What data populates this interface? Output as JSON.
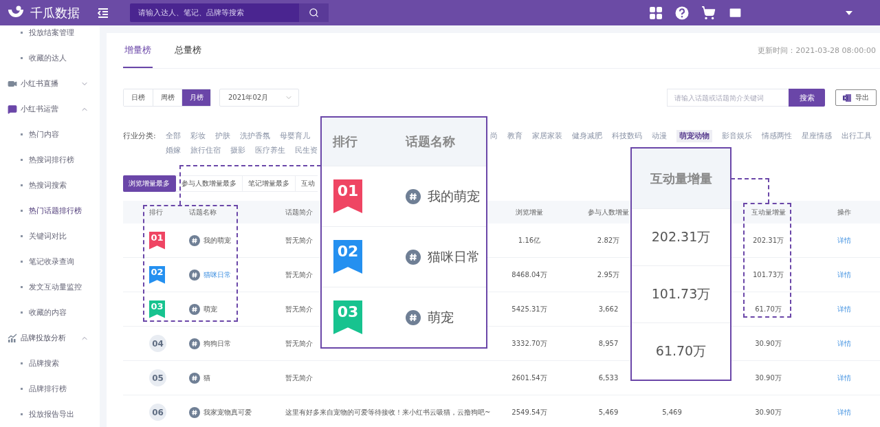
{
  "app": {
    "logo": "千瓜数据",
    "search_placeholder": "请输入达人、笔记、品牌等搜索"
  },
  "sidebar": {
    "items": [
      {
        "kind": "link",
        "label": "投放结案管理",
        "selected": false
      },
      {
        "kind": "link",
        "label": "收藏的达人",
        "selected": false
      },
      {
        "kind": "group",
        "label": "小红书直播",
        "expanded": false
      },
      {
        "kind": "group",
        "label": "小红书运营",
        "expanded": true,
        "children": [
          {
            "kind": "link",
            "label": "热门内容",
            "selected": false
          },
          {
            "kind": "link",
            "label": "热搜词排行榜",
            "selected": false
          },
          {
            "kind": "link",
            "label": "热搜词搜索",
            "selected": false
          },
          {
            "kind": "link",
            "label": "热门话题排行榜",
            "selected": true
          },
          {
            "kind": "link",
            "label": "关键词对比",
            "selected": false
          },
          {
            "kind": "link",
            "label": "笔记收录查询",
            "selected": false
          },
          {
            "kind": "link",
            "label": "发文互动量监控",
            "selected": false
          },
          {
            "kind": "link",
            "label": "收藏的内容",
            "selected": false
          }
        ]
      },
      {
        "kind": "group",
        "label": "品牌投放分析",
        "expanded": true,
        "children": [
          {
            "kind": "link",
            "label": "品牌搜索",
            "selected": false
          },
          {
            "kind": "link",
            "label": "品牌排行榜",
            "selected": false
          },
          {
            "kind": "link",
            "label": "投放报告导出",
            "selected": false
          }
        ]
      }
    ]
  },
  "board_tabs": [
    {
      "label": "增量榜",
      "selected": true
    },
    {
      "label": "总量榜",
      "selected": false
    }
  ],
  "update_time": "更新时间：2021-03-28 08:00:00",
  "period_tabs": [
    {
      "label": "日榜",
      "selected": false
    },
    {
      "label": "周榜",
      "selected": false
    },
    {
      "label": "月榜",
      "selected": true
    }
  ],
  "month_select": {
    "value": "2021年02月"
  },
  "topic_search": {
    "placeholder": "请输入话题或话题简介关键词",
    "button": "搜索"
  },
  "export_button": "导出",
  "industry": {
    "label": "行业分类:",
    "groups": [
      {
        "items": [
          {
            "label": "全部",
            "selected": false
          },
          {
            "label": "彩妆",
            "selected": false
          },
          {
            "label": "护肤",
            "selected": false
          },
          {
            "label": "洗护香氛",
            "selected": false
          },
          {
            "label": "母婴育儿",
            "selected": false
          }
        ]
      },
      {
        "items": [
          {
            "label": "尚",
            "selected": false
          },
          {
            "label": "教育",
            "selected": false
          },
          {
            "label": "家居家装",
            "selected": false
          },
          {
            "label": "健身减肥",
            "selected": false
          },
          {
            "label": "科技数码",
            "selected": false
          },
          {
            "label": "动漫",
            "selected": false
          },
          {
            "label": "萌宠动物",
            "selected": true
          },
          {
            "label": "影音娱乐",
            "selected": false
          },
          {
            "label": "情感两性",
            "selected": false
          },
          {
            "label": "星座情感",
            "selected": false
          },
          {
            "label": "出行工具",
            "selected": false
          }
        ]
      },
      {
        "items": [
          {
            "label": "婚嫁",
            "selected": false
          },
          {
            "label": "旅行住宿",
            "selected": false
          },
          {
            "label": "摄影",
            "selected": false
          },
          {
            "label": "医疗养生",
            "selected": false
          },
          {
            "label": "民生资",
            "selected": false
          }
        ]
      }
    ]
  },
  "sort_tabs": [
    {
      "label": "浏览增量最多",
      "selected": true
    },
    {
      "label": "参与人数增量最多",
      "selected": false
    },
    {
      "label": "笔记增量最多",
      "selected": false
    },
    {
      "label": "互动",
      "selected": false
    }
  ],
  "table": {
    "columns": [
      {
        "kind": "rank",
        "label": "排行"
      },
      {
        "kind": "topic",
        "label": "话题名称"
      },
      {
        "kind": "text",
        "label": "话题简介"
      },
      {
        "kind": "number",
        "label": "浏览增量"
      },
      {
        "kind": "number",
        "label": "参与人数增量"
      },
      {
        "kind": "number"
      },
      {
        "kind": "number",
        "label": "互动量增量"
      },
      {
        "kind": "link",
        "label": "操作"
      }
    ],
    "rows": [
      {
        "rank": "01",
        "kind": "ribbon",
        "color": "#ef4563",
        "name": "我的萌宠",
        "highlighted": false,
        "intro": "暂无简介",
        "views": "1.16亿",
        "participants": "2.82万",
        "interaction": "202.31万",
        "action": "详情"
      },
      {
        "rank": "02",
        "kind": "ribbon",
        "color": "#2490f0",
        "name": "猫咪日常",
        "highlighted": true,
        "intro": "暂无简介",
        "views": "8468.04万",
        "participants": "2.95万",
        "interaction": "101.73万",
        "action": "详情"
      },
      {
        "rank": "03",
        "kind": "ribbon",
        "color": "#17c38f",
        "name": "萌宠",
        "highlighted": false,
        "intro": "暂无简介",
        "views": "5425.31万",
        "participants": "3,662",
        "interaction": "61.70万",
        "action": "详情"
      },
      {
        "rank": "04",
        "kind": "circle",
        "name": "狗狗日常",
        "highlighted": false,
        "intro": "暂无简介",
        "views": "3332.70万",
        "participants": "8,957",
        "interaction": "30.90万",
        "action": "详情"
      },
      {
        "rank": "05",
        "kind": "circle",
        "name": "猫",
        "highlighted": false,
        "intro": "暂无简介",
        "views": "2601.54万",
        "participants": "6,533",
        "interaction": "30.90万",
        "action": "详情"
      },
      {
        "rank": "06",
        "kind": "circle",
        "name": "我家宠物真可爱",
        "highlighted": false,
        "intro": "这里有好多来自宠物的可爱等待接收！来小红书云吸猫，云撸狗吧~",
        "views": "2549.54万",
        "participants": "5,469",
        "column_6": "5,469",
        "interaction": "30.90万",
        "action": "详情"
      }
    ]
  },
  "topic_callout": {
    "columns": [
      "排行",
      "话题名称"
    ],
    "rows": [
      {
        "rank": "01",
        "color": "#ef4563",
        "name": "我的萌宠"
      },
      {
        "rank": "02",
        "color": "#2490f0",
        "name": "猫咪日常"
      },
      {
        "rank": "03",
        "color": "#17c38f",
        "name": "萌宠"
      }
    ]
  },
  "interaction_callout": {
    "column": "互动量增量",
    "values": [
      "202.31万",
      "101.73万",
      "61.70万"
    ]
  }
}
